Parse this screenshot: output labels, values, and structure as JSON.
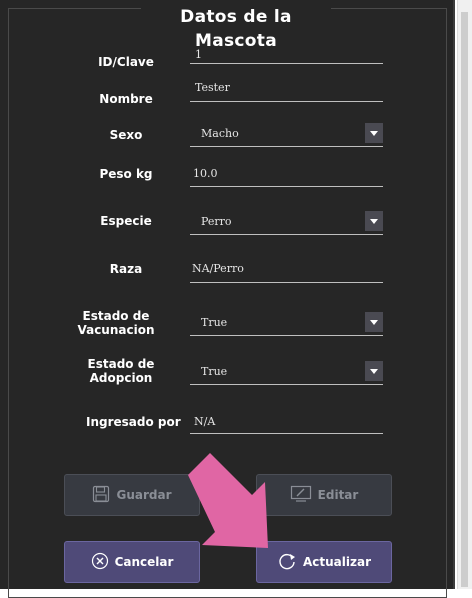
{
  "form": {
    "title": "Datos de la Mascota",
    "fields": {
      "id": {
        "label": "ID/Clave",
        "value": "1"
      },
      "nombre": {
        "label": "Nombre",
        "value": "Tester"
      },
      "sexo": {
        "label": "Sexo",
        "value": "Macho"
      },
      "peso": {
        "label": "Peso kg",
        "value": "10.0"
      },
      "especie": {
        "label": "Especie",
        "value": "Perro"
      },
      "raza": {
        "label": "Raza",
        "value": "NA/Perro"
      },
      "vacunacion": {
        "label_line1": "Estado de",
        "label_line2": "Vacunacion",
        "value": "True"
      },
      "adopcion": {
        "label_line1": "Estado de",
        "label_line2": "Adopcion",
        "value": "True"
      },
      "ingresado": {
        "label": "Ingresado por",
        "value": "N/A"
      }
    }
  },
  "buttons": {
    "guardar": {
      "label": "Guardar",
      "enabled": false,
      "icon": "save-icon"
    },
    "editar": {
      "label": "Editar",
      "enabled": false,
      "icon": "edit-icon"
    },
    "cancelar": {
      "label": "Cancelar",
      "enabled": true,
      "icon": "cancel-circle-icon"
    },
    "actualizar": {
      "label": "Actualizar",
      "enabled": true,
      "icon": "refresh-icon"
    }
  },
  "overlay": {
    "arrow_color": "#e066a4",
    "arrow_direction": "down-right"
  },
  "colors": {
    "panel_bg": "#262626",
    "active_button": "#4f4a78",
    "disabled_button": "#373a41"
  }
}
